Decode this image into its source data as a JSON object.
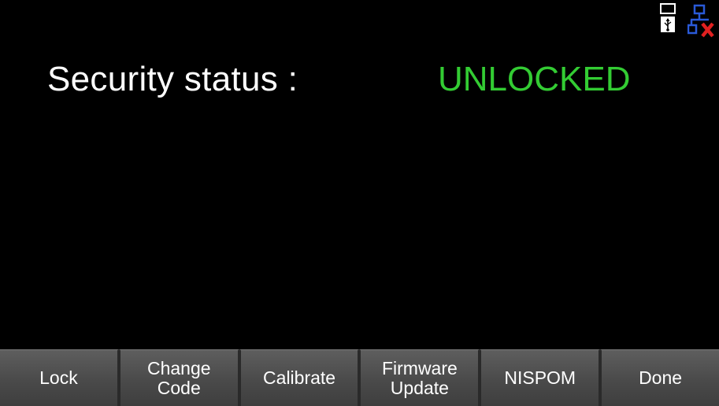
{
  "status_icons": {
    "usb": "usb-storage-icon",
    "lan": "lan-disconnected-icon"
  },
  "security": {
    "label": "Security status :",
    "value": "UNLOCKED",
    "value_color": "#33cc33"
  },
  "softkeys": [
    {
      "label": "Lock"
    },
    {
      "label": "Change\nCode"
    },
    {
      "label": "Calibrate"
    },
    {
      "label": "Firmware\nUpdate"
    },
    {
      "label": "NISPOM"
    },
    {
      "label": "Done"
    }
  ],
  "colors": {
    "background": "#000000",
    "text": "#ffffff",
    "lan_icon": "#2a5ad8",
    "lan_error": "#e02020"
  }
}
